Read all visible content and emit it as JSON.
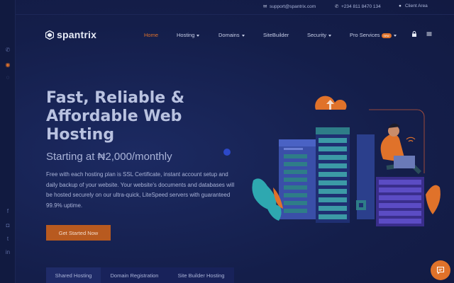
{
  "topbar": {
    "email": "support@spantrix.com",
    "phone": "+234 811 8470 134",
    "client_area": "Client Area"
  },
  "brand": {
    "name": "spantrix"
  },
  "nav": {
    "items": [
      {
        "label": "Home",
        "active": true
      },
      {
        "label": "Hosting",
        "dropdown": true
      },
      {
        "label": "Domains",
        "dropdown": true
      },
      {
        "label": "SiteBuilder"
      },
      {
        "label": "Security",
        "dropdown": true
      },
      {
        "label": "Pro Services",
        "badge": "new",
        "dropdown": true
      }
    ]
  },
  "hero": {
    "title": "Fast, Reliable & Affordable Web Hosting",
    "subtitle": "Starting at ₦2,000/monthly",
    "description": "Free with each hosting plan is SSL Certificate, instant account setup and daily backup of your website. Your website's documents and databases will be hosted securely on our ultra-quick, LiteSpeed servers with guaranteed 99.9% uptime.",
    "cta_label": "Get Started Now"
  },
  "tabs": [
    {
      "label": "Shared Hosting",
      "active": true
    },
    {
      "label": "Domain Registration"
    },
    {
      "label": "Site Builder Hosting"
    }
  ],
  "icons": {
    "rail": [
      "phone-icon",
      "target-icon",
      "chat-icon",
      "facebook-icon",
      "instagram-icon",
      "twitter-icon",
      "linkedin-icon"
    ],
    "top": [
      "mail-icon",
      "phone-icon",
      "user-icon"
    ],
    "nav": [
      "lock-icon",
      "menu-icon"
    ],
    "floating": "chat-bubble-icon"
  },
  "colors": {
    "accent": "#e0722a",
    "background": "#141e4a",
    "text": "#aab4d8"
  }
}
